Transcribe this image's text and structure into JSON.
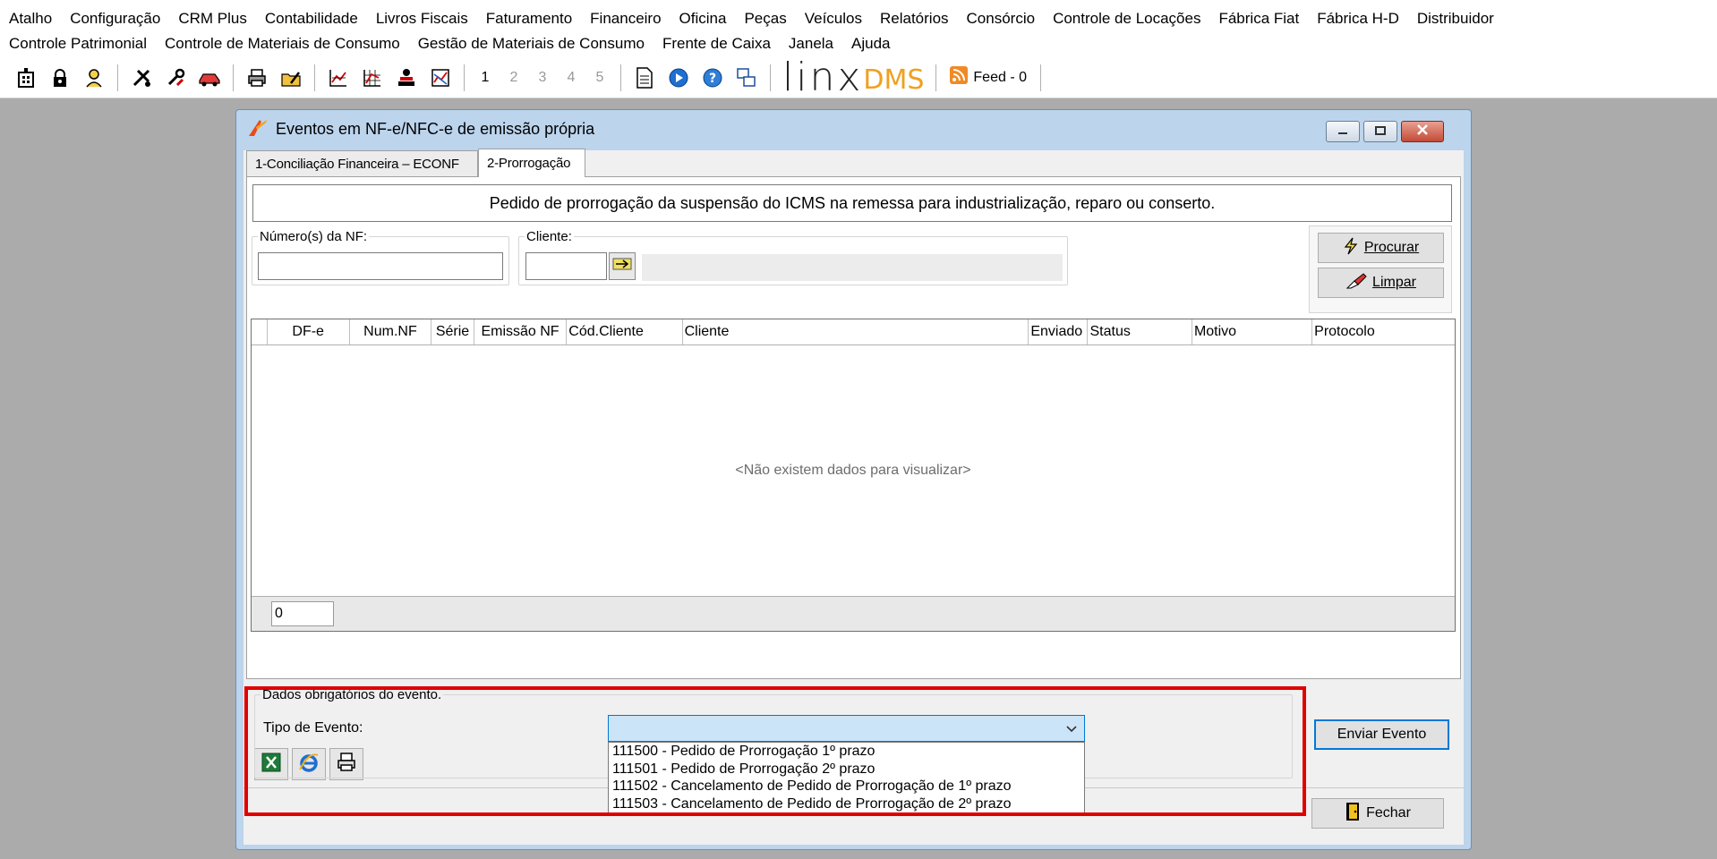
{
  "menubar": {
    "row1": [
      "Atalho",
      "Configuração",
      "CRM Plus",
      "Contabilidade",
      "Livros Fiscais",
      "Faturamento",
      "Financeiro",
      "Oficina",
      "Peças",
      "Veículos",
      "Relatórios",
      "Consórcio",
      "Controle de Locações",
      "Fábrica Fiat",
      "Fábrica H-D",
      "Distribuidor"
    ],
    "row2": [
      "Controle Patrimonial",
      "Controle de Materiais de Consumo",
      "Gestão de Materiais de Consumo",
      "Frente de Caixa",
      "Janela",
      "Ajuda"
    ]
  },
  "toolbar": {
    "numbers": [
      "1",
      "2",
      "3",
      "4",
      "5"
    ],
    "brand_linx": "linx",
    "brand_dms": "DMS",
    "feed_label": "Feed - 0"
  },
  "window": {
    "title": "Eventos em NF-e/NFC-e de emissão própria",
    "tabs": [
      {
        "label": "1-Conciliação Financeira – ECONF",
        "active": false
      },
      {
        "label": "2-Prorrogação",
        "active": true
      }
    ],
    "banner": "Pedido de prorrogação da suspensão do ICMS na remessa para industrialização, reparo ou conserto.",
    "filters": {
      "numero_nf_label": "Número(s) da NF:",
      "numero_nf_value": "",
      "cliente_label": "Cliente:",
      "cliente_code": "",
      "cliente_name": ""
    },
    "buttons": {
      "procurar": "Procurar",
      "limpar": "Limpar",
      "enviar_evento": "Enviar Evento",
      "fechar": "Fechar"
    },
    "grid": {
      "columns": [
        "",
        "DF-e",
        "Num.NF",
        "Série",
        "Emissão NF",
        "Cód.Cliente",
        "Cliente",
        "Enviado",
        "Status",
        "Motivo",
        "Protocolo"
      ],
      "empty_message": "<Não existem dados para visualizar>",
      "row_count": "0"
    },
    "evento": {
      "group_label": "Dados obrigatórios do evento.",
      "tipo_label": "Tipo de Evento:",
      "tipo_value": "",
      "options": [
        "111500 - Pedido de  Prorrogação 1º prazo",
        "111501 - Pedido de  Prorrogação 2º prazo",
        "111502 - Cancelamento de Pedido de Prorrogação de 1º prazo",
        "111503 - Cancelamento de Pedido de Prorrogação de 2º prazo"
      ]
    }
  },
  "colors": {
    "accent": "#0078d7",
    "highlight": "#e00000",
    "select_bg": "#cce4f7",
    "window_frame": "#bcd4ec"
  }
}
